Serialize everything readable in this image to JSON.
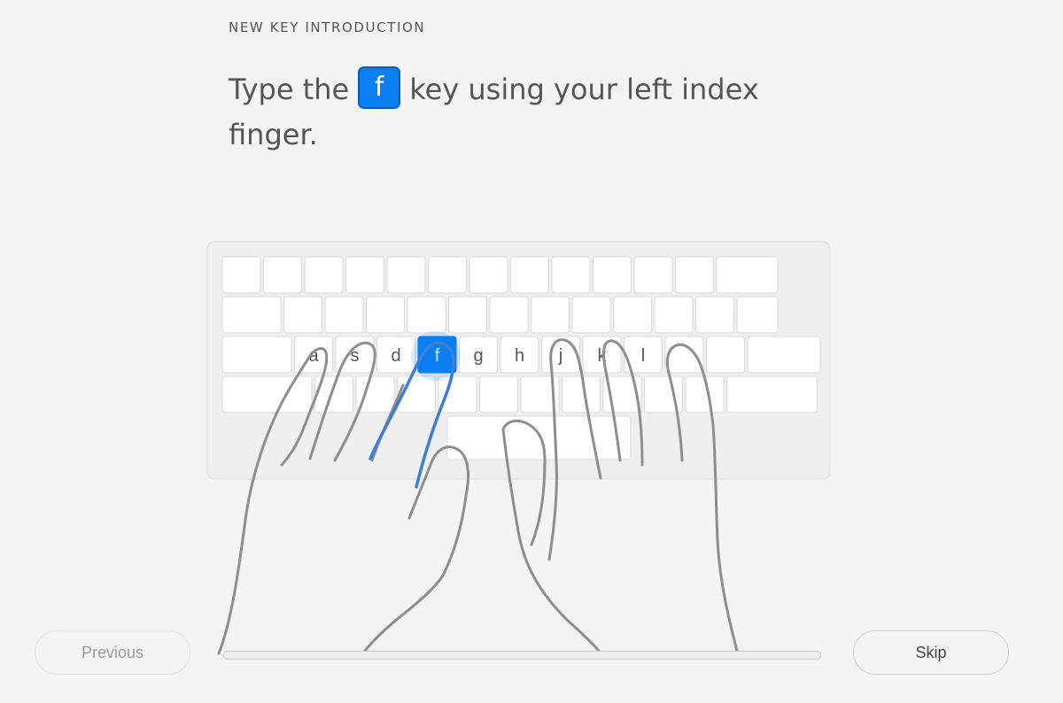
{
  "lesson": {
    "eyebrow": "NEW KEY INTRODUCTION",
    "instruction_before": "Type the",
    "target_key": "f",
    "instruction_after": "key using your left index finger."
  },
  "keyboard": {
    "home_row_labels": [
      "a",
      "s",
      "d",
      "f",
      "g",
      "h",
      "j",
      "k",
      "l"
    ],
    "highlighted_key": "f",
    "highlight_color": "#0a7ff2",
    "hand_outline_color": "#8e8e8e",
    "guide_finger_color": "#3d7fd6"
  },
  "navigation": {
    "previous_label": "Previous",
    "skip_label": "Skip"
  },
  "progress": {
    "fraction": 0
  }
}
